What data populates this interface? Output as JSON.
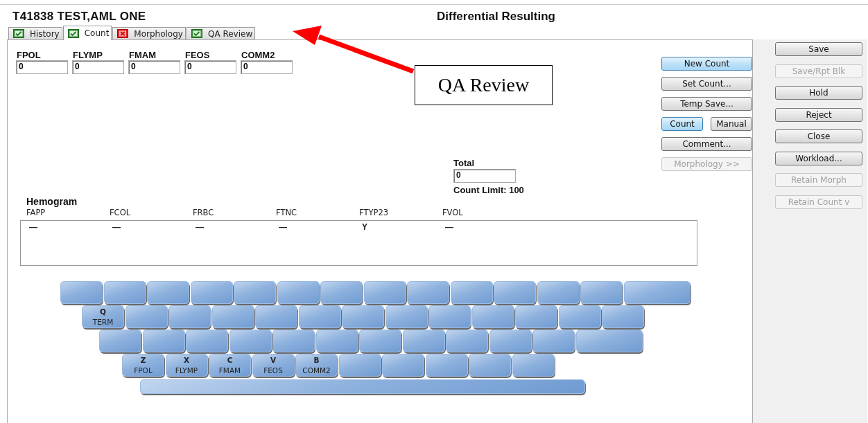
{
  "header": {
    "patient": "T41838 TEST,AML ONE",
    "title": "Differential Resulting"
  },
  "tabs": [
    {
      "label": "History",
      "error": false,
      "selected": false
    },
    {
      "label": "Count",
      "error": false,
      "selected": true
    },
    {
      "label": "Morphology",
      "error": true,
      "selected": false
    },
    {
      "label": "QA Review",
      "error": false,
      "selected": false
    }
  ],
  "count_fields": [
    {
      "label": "FPOL",
      "value": "0"
    },
    {
      "label": "FLYMP",
      "value": "0"
    },
    {
      "label": "FMAM",
      "value": "0"
    },
    {
      "label": "FEOS",
      "value": "0"
    },
    {
      "label": "COMM2",
      "value": "0"
    }
  ],
  "action_buttons": [
    {
      "label": "New Count",
      "kind": "full",
      "highlighted": true,
      "disabled": false
    },
    {
      "label": "Set Count...",
      "kind": "full",
      "highlighted": false,
      "disabled": false
    },
    {
      "label": "Temp Save...",
      "kind": "full",
      "highlighted": false,
      "disabled": false
    },
    {
      "label": "Count",
      "kind": "half",
      "highlighted": true,
      "disabled": false
    },
    {
      "label": "Manual",
      "kind": "half",
      "highlighted": false,
      "disabled": false
    },
    {
      "label": "Comment...",
      "kind": "full",
      "highlighted": false,
      "disabled": false
    },
    {
      "label": "Morphology >>",
      "kind": "full",
      "highlighted": false,
      "disabled": true
    }
  ],
  "total": {
    "label": "Total",
    "value": "0",
    "limit": "Count Limit: 100"
  },
  "hemogram": {
    "title": "Hemogram",
    "columns": [
      {
        "name": "FAPP",
        "value": "—"
      },
      {
        "name": "FCOL",
        "value": "—"
      },
      {
        "name": "FRBC",
        "value": "—"
      },
      {
        "name": "FTNC",
        "value": "—"
      },
      {
        "name": "FTYP23",
        "value": "Y"
      },
      {
        "name": "FVOL",
        "value": "—"
      }
    ]
  },
  "keyboard": [
    [
      {
        "kind": "key"
      },
      {
        "kind": "key"
      },
      {
        "kind": "key"
      },
      {
        "kind": "key"
      },
      {
        "kind": "key"
      },
      {
        "kind": "key"
      },
      {
        "kind": "key"
      },
      {
        "kind": "key"
      },
      {
        "kind": "key"
      },
      {
        "kind": "key"
      },
      {
        "kind": "key"
      },
      {
        "kind": "key"
      },
      {
        "kind": "key"
      },
      {
        "kind": "wide"
      }
    ],
    [
      {
        "kind": "key",
        "letter": "Q",
        "caption": "TERM"
      },
      {
        "kind": "key"
      },
      {
        "kind": "key"
      },
      {
        "kind": "key"
      },
      {
        "kind": "key"
      },
      {
        "kind": "key"
      },
      {
        "kind": "key"
      },
      {
        "kind": "key"
      },
      {
        "kind": "key"
      },
      {
        "kind": "key"
      },
      {
        "kind": "key"
      },
      {
        "kind": "key"
      },
      {
        "kind": "key"
      }
    ],
    [
      {
        "kind": "key"
      },
      {
        "kind": "key"
      },
      {
        "kind": "key"
      },
      {
        "kind": "key"
      },
      {
        "kind": "key"
      },
      {
        "kind": "key"
      },
      {
        "kind": "key"
      },
      {
        "kind": "key"
      },
      {
        "kind": "key"
      },
      {
        "kind": "key"
      },
      {
        "kind": "key"
      },
      {
        "kind": "wide"
      }
    ],
    [
      {
        "kind": "key",
        "letter": "Z",
        "caption": "FPOL"
      },
      {
        "kind": "key",
        "letter": "X",
        "caption": "FLYMP"
      },
      {
        "kind": "key",
        "letter": "C",
        "caption": "FMAM"
      },
      {
        "kind": "key",
        "letter": "V",
        "caption": "FEOS"
      },
      {
        "kind": "key",
        "letter": "B",
        "caption": "COMM2"
      },
      {
        "kind": "key"
      },
      {
        "kind": "key"
      },
      {
        "kind": "key"
      },
      {
        "kind": "key"
      },
      {
        "kind": "key"
      }
    ],
    [
      {
        "kind": "space"
      }
    ]
  ],
  "side_buttons": [
    {
      "label": "Save",
      "disabled": false
    },
    {
      "label": "Save/Rpt Blk",
      "disabled": true
    },
    {
      "label": "Hold",
      "disabled": false
    },
    {
      "label": "Reject",
      "disabled": false
    },
    {
      "label": "Close",
      "disabled": false
    },
    {
      "label": "Workload...",
      "disabled": false
    },
    {
      "label": "Retain Morph",
      "disabled": true
    },
    {
      "label": "Retain Count v",
      "disabled": true
    }
  ],
  "callout": {
    "text": "QA Review"
  }
}
